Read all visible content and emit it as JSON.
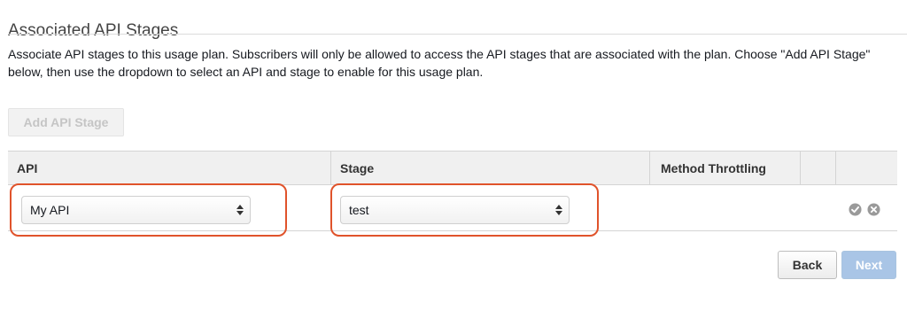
{
  "page": {
    "title": "Associated API Stages",
    "description": "Associate API stages to this usage plan. Subscribers will only be allowed to access the API stages that are associated with the plan. Choose \"Add API Stage\" below, then use the dropdown to select an API and stage to enable for this usage plan."
  },
  "toolbar": {
    "add_stage_label": "Add API Stage"
  },
  "table": {
    "headers": {
      "api": "API",
      "stage": "Stage",
      "method_throttling": "Method Throttling"
    },
    "row": {
      "api_value": "My API",
      "stage_value": "test",
      "confirm_icon": "check-circle-icon",
      "cancel_icon": "x-circle-icon"
    }
  },
  "footer": {
    "back_label": "Back",
    "next_label": "Next"
  },
  "colors": {
    "highlight": "#e0532b",
    "next_button": "#a9c5e6",
    "header_bg": "#f0f0f0"
  }
}
